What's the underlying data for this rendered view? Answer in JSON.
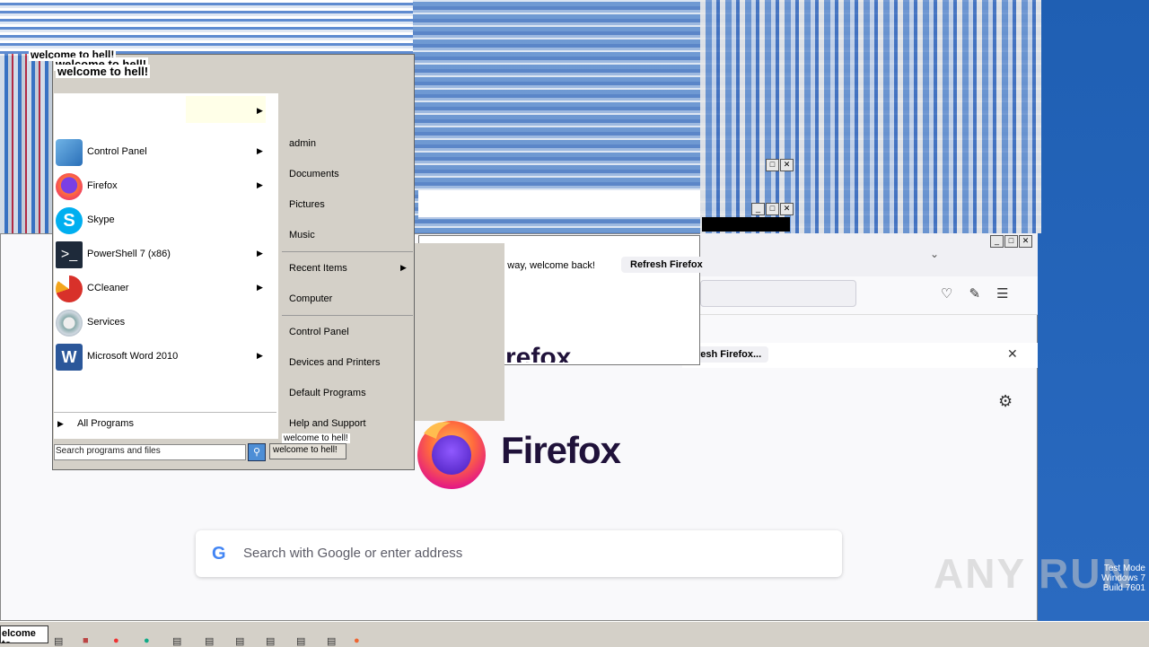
{
  "start_menu": {
    "welcome_text": "welcome to hell!",
    "programs": [
      {
        "label": "Control Panel",
        "icon": "control-panel-icon",
        "has_submenu": true
      },
      {
        "label": "Firefox",
        "icon": "firefox-icon",
        "has_submenu": true
      },
      {
        "label": "Skype",
        "icon": "skype-icon",
        "has_submenu": false
      },
      {
        "label": "PowerShell 7 (x86)",
        "icon": "powershell-icon",
        "has_submenu": true
      },
      {
        "label": "CCleaner",
        "icon": "ccleaner-icon",
        "has_submenu": true
      },
      {
        "label": "Services",
        "icon": "services-icon",
        "has_submenu": false
      },
      {
        "label": "Microsoft Word 2010",
        "icon": "word-icon",
        "has_submenu": true
      }
    ],
    "all_programs": "All Programs",
    "search_placeholder": "Search programs and files",
    "right_items": [
      "admin",
      "Documents",
      "Pictures",
      "Music",
      "Recent Items",
      "Computer",
      "Control Panel",
      "Devices and Printers",
      "Default Programs",
      "Help and Support"
    ],
    "shutdown_label": "welcome to hell!"
  },
  "firefox": {
    "notification_text": "ne way, welcome back!",
    "refresh_button": "Refresh Firefox",
    "refresh_button_2": "resh Firefox...",
    "brand_partial": "refox",
    "brand": "Firefox",
    "search_placeholder": "Search with Google or enter address"
  },
  "taskbar": {
    "start_label": "elcome to"
  },
  "watermark": {
    "text": "ANY RUN",
    "build_lines": [
      "Test Mode",
      "Windows 7",
      "Build 7601"
    ]
  },
  "colors": {
    "desktop_blue": "#1a5aa8",
    "start_menu_bg": "#d4d0c8",
    "firefox_text": "#20123a"
  }
}
